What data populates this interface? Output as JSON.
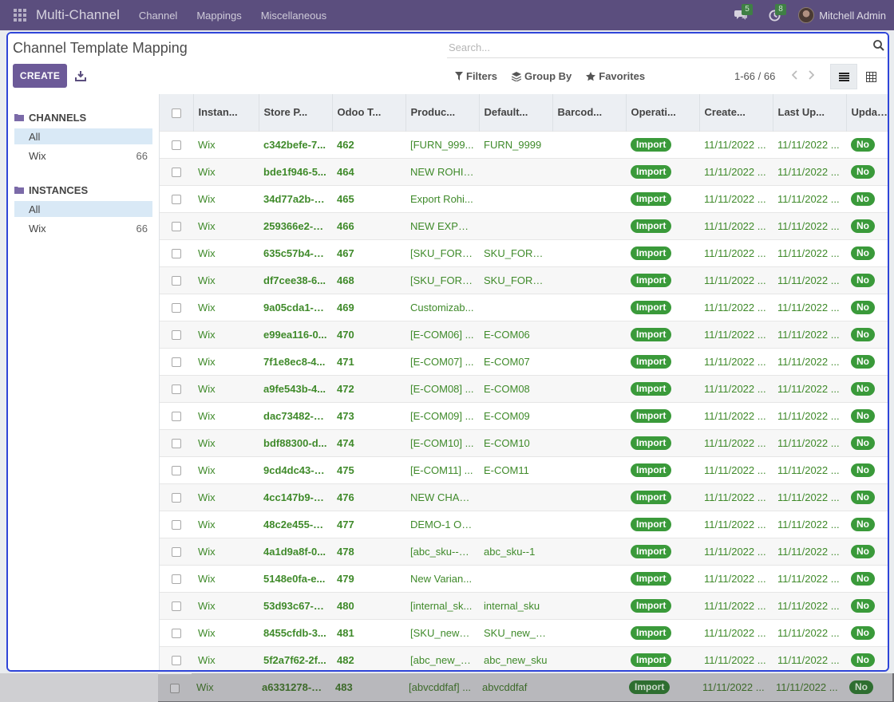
{
  "navbar": {
    "app_name": "Multi-Channel",
    "menu": [
      "Channel",
      "Mappings",
      "Miscellaneous"
    ],
    "messages_count": "5",
    "activities_count": "8",
    "user_name": "Mitchell Admin"
  },
  "control_panel": {
    "title": "Channel Template Mapping",
    "create_label": "CREATE",
    "search_placeholder": "Search...",
    "filters_label": "Filters",
    "groupby_label": "Group By",
    "favorites_label": "Favorites",
    "pager": "1-66 / 66"
  },
  "sidebar": {
    "channels_header": "CHANNELS",
    "channels": [
      {
        "label": "All",
        "count": ""
      },
      {
        "label": "Wix",
        "count": "66"
      }
    ],
    "instances_header": "INSTANCES",
    "instances": [
      {
        "label": "All",
        "count": ""
      },
      {
        "label": "Wix",
        "count": "66"
      }
    ]
  },
  "table": {
    "headers": [
      "Instan...",
      "Store P...",
      "Odoo T...",
      "Produc...",
      "Default...",
      "Barcod...",
      "Operati...",
      "Create...",
      "Last Up...",
      "Update ..."
    ],
    "rows": [
      [
        "Wix",
        "c342befe-7...",
        "462",
        "[FURN_999...",
        "FURN_9999",
        "",
        "Import",
        "11/11/2022 ...",
        "11/11/2022 ...",
        "No"
      ],
      [
        "Wix",
        "bde1f946-5...",
        "464",
        "NEW ROHIT...",
        "",
        "",
        "Import",
        "11/11/2022 ...",
        "11/11/2022 ...",
        "No"
      ],
      [
        "Wix",
        "34d77a2b-d...",
        "465",
        "Export Rohi...",
        "",
        "",
        "Import",
        "11/11/2022 ...",
        "11/11/2022 ...",
        "No"
      ],
      [
        "Wix",
        "259366e2-6...",
        "466",
        "NEW EXPO...",
        "",
        "",
        "Import",
        "11/11/2022 ...",
        "11/11/2022 ...",
        "No"
      ],
      [
        "Wix",
        "635c57b4-4...",
        "467",
        "[SKU_FOR_...",
        "SKU_FOR_P...",
        "",
        "Import",
        "11/11/2022 ...",
        "11/11/2022 ...",
        "No"
      ],
      [
        "Wix",
        "df7cee38-6...",
        "468",
        "[SKU_FOR_...",
        "SKU_FOR_P...",
        "",
        "Import",
        "11/11/2022 ...",
        "11/11/2022 ...",
        "No"
      ],
      [
        "Wix",
        "9a05cda1-0...",
        "469",
        "Customizab...",
        "",
        "",
        "Import",
        "11/11/2022 ...",
        "11/11/2022 ...",
        "No"
      ],
      [
        "Wix",
        "e99ea116-0...",
        "470",
        "[E-COM06] ...",
        "E-COM06",
        "",
        "Import",
        "11/11/2022 ...",
        "11/11/2022 ...",
        "No"
      ],
      [
        "Wix",
        "7f1e8ec8-4...",
        "471",
        "[E-COM07] ...",
        "E-COM07",
        "",
        "Import",
        "11/11/2022 ...",
        "11/11/2022 ...",
        "No"
      ],
      [
        "Wix",
        "a9fe543b-4...",
        "472",
        "[E-COM08] ...",
        "E-COM08",
        "",
        "Import",
        "11/11/2022 ...",
        "11/11/2022 ...",
        "No"
      ],
      [
        "Wix",
        "dac73482-4...",
        "473",
        "[E-COM09] ...",
        "E-COM09",
        "",
        "Import",
        "11/11/2022 ...",
        "11/11/2022 ...",
        "No"
      ],
      [
        "Wix",
        "bdf88300-d...",
        "474",
        "[E-COM10] ...",
        "E-COM10",
        "",
        "Import",
        "11/11/2022 ...",
        "11/11/2022 ...",
        "No"
      ],
      [
        "Wix",
        "9cd4dc43-0...",
        "475",
        "[E-COM11] ...",
        "E-COM11",
        "",
        "Import",
        "11/11/2022 ...",
        "11/11/2022 ...",
        "No"
      ],
      [
        "Wix",
        "4cc147b9-3...",
        "476",
        "NEW CHAN...",
        "",
        "",
        "Import",
        "11/11/2022 ...",
        "11/11/2022 ...",
        "No"
      ],
      [
        "Wix",
        "48c2e455-3...",
        "477",
        "DEMO-1 Od...",
        "",
        "",
        "Import",
        "11/11/2022 ...",
        "11/11/2022 ...",
        "No"
      ],
      [
        "Wix",
        "4a1d9a8f-0...",
        "478",
        "[abc_sku--1]...",
        "abc_sku--1",
        "",
        "Import",
        "11/11/2022 ...",
        "11/11/2022 ...",
        "No"
      ],
      [
        "Wix",
        "5148e0fa-e...",
        "479",
        "New Varian...",
        "",
        "",
        "Import",
        "11/11/2022 ...",
        "11/11/2022 ...",
        "No"
      ],
      [
        "Wix",
        "53d93c67-e...",
        "480",
        "[internal_sk...",
        "internal_sku",
        "",
        "Import",
        "11/11/2022 ...",
        "11/11/2022 ...",
        "No"
      ],
      [
        "Wix",
        "8455cfdb-3...",
        "481",
        "[SKU_new_c...",
        "SKU_new_c...",
        "",
        "Import",
        "11/11/2022 ...",
        "11/11/2022 ...",
        "No"
      ],
      [
        "Wix",
        "5f2a7f62-2f...",
        "482",
        "[abc_new_s...",
        "abc_new_sku",
        "",
        "Import",
        "11/11/2022 ...",
        "11/11/2022 ...",
        "No"
      ]
    ],
    "overflow_row": [
      "Wix",
      "a6331278-e...",
      "483",
      "[abvcddfaf] ...",
      "abvcddfaf",
      "",
      "Import",
      "11/11/2022 ...",
      "11/11/2022 ...",
      "No"
    ]
  }
}
